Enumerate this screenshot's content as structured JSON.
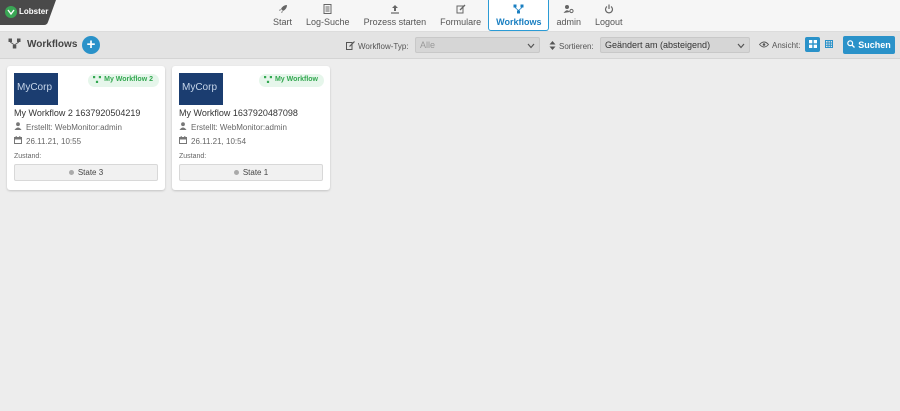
{
  "app": {
    "logo_text": "Lobster"
  },
  "nav": {
    "items": [
      {
        "id": "start",
        "label": "Start",
        "icon": "rocket-icon"
      },
      {
        "id": "log",
        "label": "Log-Suche",
        "icon": "document-icon"
      },
      {
        "id": "process",
        "label": "Prozess starten",
        "icon": "upload-icon"
      },
      {
        "id": "forms",
        "label": "Formulare",
        "icon": "edit-icon"
      },
      {
        "id": "workflows",
        "label": "Workflows",
        "icon": "workflow-icon",
        "active": true
      },
      {
        "id": "admin",
        "label": "admin",
        "icon": "user-gear-icon"
      },
      {
        "id": "logout",
        "label": "Logout",
        "icon": "power-icon"
      }
    ]
  },
  "toolbar": {
    "title": "Workflows",
    "add_label": "+",
    "type_label": "Workflow-Typ:",
    "type_value": "Alle",
    "sort_label": "Sortieren:",
    "sort_value": "Geändert am (absteigend)",
    "view_label": "Ansicht:",
    "search_label": "Suchen"
  },
  "colors": {
    "accent": "#2a92c9",
    "badge_green": "#33a850",
    "logo_bg": "#1b3d70"
  },
  "cards": [
    {
      "logo_text": "MyCorp",
      "badge": "My Workflow 2",
      "title": "My Workflow 2 1637920504219",
      "created": "Erstellt: WebMonitor:admin",
      "date": "26.11.21, 10:55",
      "state_label": "Zustand:",
      "state": "State 3"
    },
    {
      "logo_text": "MyCorp",
      "badge": "My Workflow",
      "title": "My Workflow 1637920487098",
      "created": "Erstellt: WebMonitor:admin",
      "date": "26.11.21, 10:54",
      "state_label": "Zustand:",
      "state": "State 1"
    }
  ]
}
